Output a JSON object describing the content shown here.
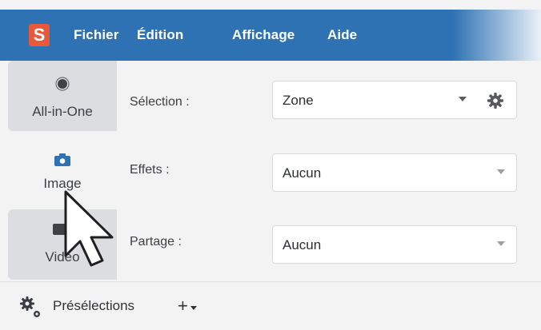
{
  "app": {
    "logo_letter": "S",
    "menu": [
      "Fichier",
      "Édition",
      "Affichage",
      "Aide"
    ]
  },
  "tabs": [
    {
      "label": "All-in-One",
      "icon": "radio-record-icon",
      "state": "inactive"
    },
    {
      "label": "Image",
      "icon": "camera-icon",
      "state": "selected"
    },
    {
      "label": "Vidéo",
      "icon": "video-camera-icon",
      "state": "inactive"
    }
  ],
  "settings": {
    "selection": {
      "label": "Sélection :",
      "value": "Zone"
    },
    "effets": {
      "label": "Effets :",
      "value": "Aucun"
    },
    "partage": {
      "label": "Partage :",
      "value": "Aucun"
    }
  },
  "footer": {
    "presets_label": "Présélections",
    "add_label": "+"
  },
  "colors": {
    "menubar": "#2f72b4",
    "logo": "#e8583a",
    "tab_inactive": "#dcdde0",
    "panel_bg": "#f3f3f3"
  }
}
